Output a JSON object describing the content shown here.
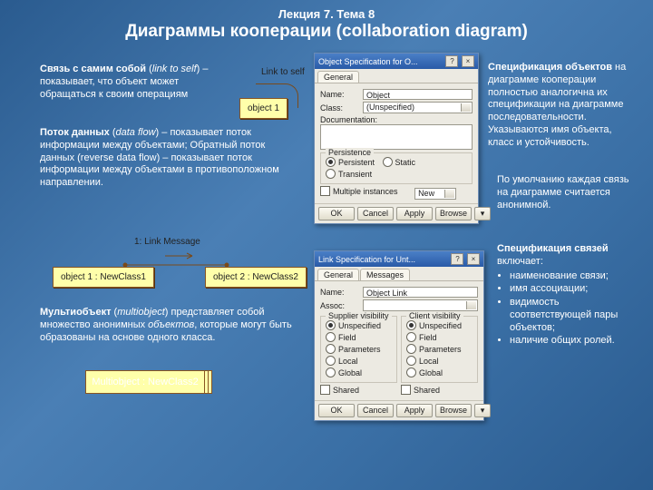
{
  "header": {
    "lecture": "Лекция 7. Тема 8",
    "title": "Диаграммы кооперации (collaboration diagram)"
  },
  "p1": {
    "bold": "Связь с самим собой",
    "paren": "link to self",
    "rest": " – показывает, что объект может обращаться к своим операциям"
  },
  "p2": {
    "bold": "Поток данных",
    "paren": "data flow",
    "rest": " – показывает поток информации между объектами; Обратный поток данных (reverse data flow) – показывает поток информации между объектами в противоположном направлении."
  },
  "p3": {
    "bold": "Мультиобъект",
    "paren": "multiobject",
    "rest": " представляет собой множество анонимных ",
    "ital": "объектов",
    "tail": ", которые могут быть образованы на основе одного класса."
  },
  "p4": {
    "bold": "Спецификация объектов",
    "rest": " на  диаграмме кооперации полностью аналогична их спецификации на диаграмме последовательности. Указываются имя объекта, класс и устойчивость."
  },
  "p5": "По умолчанию каждая связь на диаграмме считается анонимной.",
  "p6": {
    "bold": "Спецификация связей",
    "rest": " включает:",
    "items": [
      "наименование связи;",
      "имя ассоциации;",
      "видимость соответствующей пары объектов;",
      "наличие общих ролей."
    ]
  },
  "diag": {
    "link_to_self": "Link to self",
    "obj1": "object 1",
    "msg": "1: Link Message",
    "o1": "object 1 : NewClass1",
    "o2": "object 2 : NewClass2",
    "multi": "Multiobject : NewClass2"
  },
  "dlg1": {
    "title": "Object Specification for O...",
    "tabs": [
      "General"
    ],
    "name_l": "Name:",
    "name_v": "Object",
    "class_l": "Class:",
    "class_v": "(Unspecified)",
    "doc_l": "Documentation:",
    "grp": "Persistence",
    "rad": [
      "Persistent",
      "Static",
      "Transient"
    ],
    "chk": "Multiple instances",
    "btns": [
      "OK",
      "Cancel",
      "Apply",
      "Browse"
    ]
  },
  "dlg2": {
    "title": "Link Specification for Unt...",
    "tabs": [
      "General",
      "Messages"
    ],
    "name_l": "Name:",
    "name_v": "Object Link",
    "assoc_l": "Assoc:",
    "g1": "Supplier visibility",
    "g2": "Client visibility",
    "rads": [
      "Unspecified",
      "Field",
      "Parameters",
      "Local",
      "Global"
    ],
    "chk": "Shared",
    "btns": [
      "OK",
      "Cancel",
      "Apply",
      "Browse"
    ]
  }
}
